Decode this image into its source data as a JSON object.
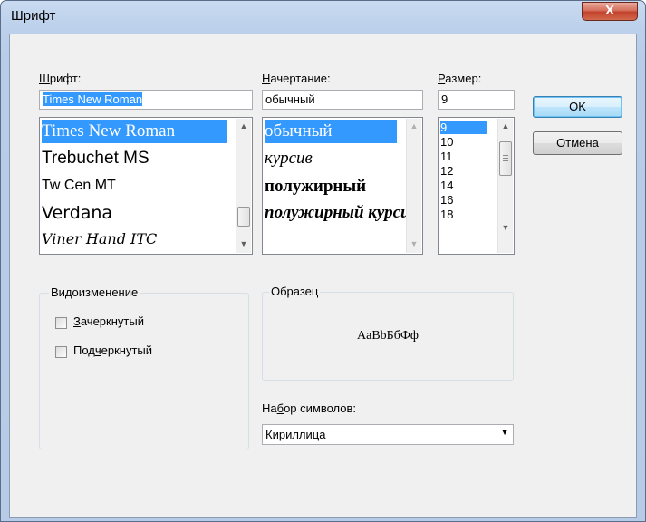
{
  "window": {
    "title": "Шрифт",
    "close": "X"
  },
  "font": {
    "label_prefix": "",
    "label_ul": "Ш",
    "label_rest": "рифт:",
    "value": "Times New Roman",
    "items": [
      {
        "label": "Times New Roman",
        "selected": true
      },
      {
        "label": "Trebuchet MS",
        "selected": false
      },
      {
        "label": "Tw Cen MT",
        "selected": false
      },
      {
        "label": "Verdana",
        "selected": false
      },
      {
        "label": "Viner Hand ITC",
        "selected": false
      }
    ]
  },
  "style": {
    "label_prefix": "",
    "label_ul": "Н",
    "label_rest": "ачертание:",
    "value": "обычный",
    "items": [
      {
        "label": "обычный",
        "selected": true
      },
      {
        "label": "курсив",
        "selected": false
      },
      {
        "label": "полужирный",
        "selected": false
      },
      {
        "label": "полужирный курсив",
        "selected": false
      }
    ]
  },
  "size": {
    "label_prefix": "",
    "label_ul": "Р",
    "label_rest": "азмер:",
    "value": "9",
    "items": [
      {
        "label": "9",
        "selected": true
      },
      {
        "label": "10",
        "selected": false
      },
      {
        "label": "11",
        "selected": false
      },
      {
        "label": "12",
        "selected": false
      },
      {
        "label": "14",
        "selected": false
      },
      {
        "label": "16",
        "selected": false
      },
      {
        "label": "18",
        "selected": false
      }
    ]
  },
  "buttons": {
    "ok": "OK",
    "cancel": "Отмена"
  },
  "effects": {
    "title": "Видоизменение",
    "strike_ul": "З",
    "strike_rest": "ачеркнутый",
    "underline_pre": "Под",
    "underline_ul": "ч",
    "underline_rest": "еркнутый"
  },
  "sample": {
    "title": "Образец",
    "text": "AaBbБбФф"
  },
  "charset": {
    "label_pre": "На",
    "label_ul": "б",
    "label_rest": "ор символов:",
    "value": "Кириллица"
  }
}
